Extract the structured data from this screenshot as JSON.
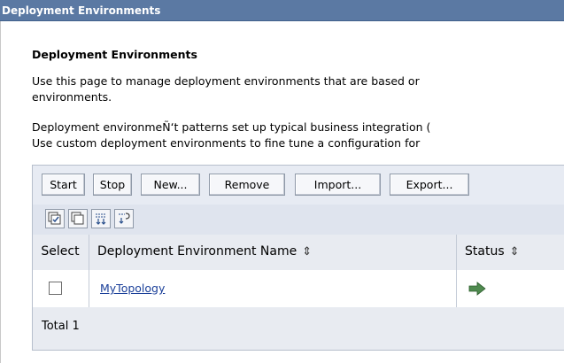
{
  "window": {
    "title": "Deployment Environments"
  },
  "content": {
    "heading": "Deployment Environments",
    "description_lines": [
      "Use this page to manage deployment environments that are based or",
      "environments.",
      "Deployment environmeÑ‘t patterns set up typical business integration (",
      "Use custom deployment environments to fine tune a configuration for"
    ]
  },
  "toolbar": {
    "buttons": [
      "Start",
      "Stop",
      "New...",
      "Remove",
      "Import...",
      "Export..."
    ]
  },
  "icon_toolbar": {
    "icons": [
      "select-all-icon",
      "deselect-all-icon",
      "show-filter-icon",
      "clear-filter-icon"
    ]
  },
  "table": {
    "columns": [
      "Select",
      "Deployment Environment Name",
      "Status"
    ],
    "sort_glyph": "⇕",
    "rows": [
      {
        "selected": false,
        "name": "MyTopology",
        "status_icon": "started-arrow-icon"
      }
    ],
    "footer": "Total 1"
  },
  "colors": {
    "titlebar": "#5b79a3",
    "link": "#1a3f99",
    "status_arrow": "#4f8a4f"
  }
}
